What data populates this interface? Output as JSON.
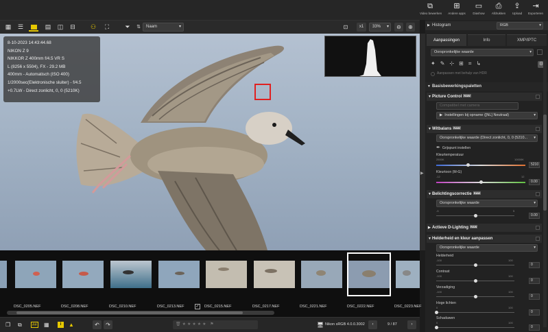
{
  "topbar": {
    "buttons": [
      {
        "icon": "edit-video-icon",
        "glyph": "⧉",
        "label": "Video bewerken"
      },
      {
        "icon": "other-apps-icon",
        "glyph": "⊞",
        "label": "Andere apps"
      },
      {
        "icon": "slideshow-icon",
        "glyph": "▭",
        "label": "Diashow"
      },
      {
        "icon": "print-icon",
        "glyph": "⎙",
        "label": "Afdrukken"
      },
      {
        "icon": "upload-icon",
        "glyph": "⇪",
        "label": "Upload"
      },
      {
        "icon": "export-icon",
        "glyph": "⇥",
        "label": "Exporteren"
      }
    ]
  },
  "toolbar": {
    "sort_label": "Naam",
    "zoom_fit": "x1",
    "zoom_level": "33%"
  },
  "viewer": {
    "info_lines": [
      "8-10-2023 14:43:44.68",
      "NIKON Z 9",
      "NIKKOR Z 400mm f/4.5 VR S",
      "L (8256 x 5504), FX - 29.2 MB",
      "400mm - Automatisch (ISO 400)",
      "1/2000sec(Elektronische sluiter) - f/4.5",
      "+0.7LW - Direct zonlicht, 0, 0 (5210K)"
    ]
  },
  "filmstrip": {
    "items": [
      {
        "name": "DSC_0205.NEF"
      },
      {
        "name": "DSC_0208.NEF"
      },
      {
        "name": "DSC_0210.NEF"
      },
      {
        "name": "DSC_0213.NEF"
      },
      {
        "name": "DSC_0215.NEF"
      },
      {
        "name": "DSC_0217.NEF"
      },
      {
        "name": "DSC_0221.NEF"
      },
      {
        "name": "DSC_0222.NEF"
      },
      {
        "name": "DSC_0223.NEF"
      }
    ],
    "selected_index": 7
  },
  "bottombar": {
    "color_profile": "Nikon sRGB 4.0.0.3002",
    "page_indicator": "9 / 87"
  },
  "panel": {
    "histogram_label": "Histogram",
    "histogram_channel": "RGB",
    "tabs": [
      "Aanpassingen",
      "Info",
      "XMP/IPTC"
    ],
    "preset": "Oorspronkelijke waarde",
    "hdr_note": "Aanpassen met behulp van HDR",
    "basic_palettes": "Basisbewerkingspaletten",
    "picture_control": {
      "title": "Picture Control",
      "compat": "Compatibel met camera",
      "setting": "Instellingen bij opname ([NL] Neutraal)"
    },
    "white_balance": {
      "title": "Witbalans",
      "value": "Oorspronkelijke waarde (Direct zonlicht, 0, 0 (5210...",
      "picker": "Grijspunt instellen",
      "temp_label": "Kleurtemperatuur",
      "temp_min": "2500K",
      "temp_max": "10000K",
      "temp_value": "5210",
      "tint_label": "Kleurtoon (M-G)",
      "tint_min": "-12",
      "tint_max": "12",
      "tint_value": "0.00",
      "temp_fraction": 0.36,
      "tint_fraction": 0.5
    },
    "exposure": {
      "title": "Belichtingscorrectie",
      "value": "Oorspronkelijke waarde",
      "min": "-5",
      "max": "5",
      "amount": "0.00",
      "fraction": 0.5
    },
    "adl": {
      "title": "Actieve D-Lighting"
    },
    "brightness": {
      "title": "Helderheid en kleur aanpassen",
      "value": "Oorspronkelijke waarde",
      "sliders": [
        {
          "label": "Helderheid",
          "min": "-100",
          "max": "100",
          "value": "0",
          "fraction": 0.5
        },
        {
          "label": "Contrast",
          "min": "-100",
          "max": "100",
          "value": "0",
          "fraction": 0.5
        },
        {
          "label": "Verzadiging",
          "min": "-100",
          "max": "100",
          "value": "0",
          "fraction": 0.5
        },
        {
          "label": "Hoge lichten",
          "min": "0",
          "max": "100",
          "value": "0",
          "fraction": 0.0
        },
        {
          "label": "Schaduwen",
          "min": "0",
          "max": "100",
          "value": "0",
          "fraction": 0.0
        }
      ]
    }
  },
  "colors": {
    "accent": "#e6c800",
    "focus_box": "#e02020",
    "selected_thumb_border": "#ffffff"
  }
}
